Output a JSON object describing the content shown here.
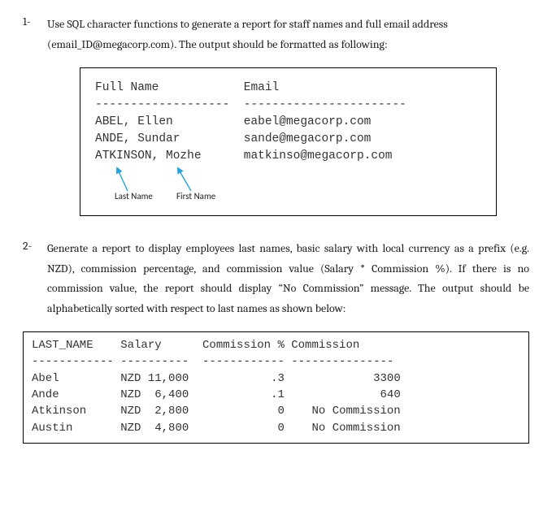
{
  "q1": {
    "number": "1-",
    "text_a": "Use SQL character functions to generate a report for staff names and full email address (email_ID@megacorp.com). The output should be formatted as following:",
    "header_full": "Full Name",
    "header_email": "Email",
    "dashes_full": "-------------------",
    "dashes_email": "-----------------------",
    "rows": [
      {
        "name": "ABEL, Ellen",
        "email": "eabel@megacorp.com"
      },
      {
        "name": "ANDE, Sundar",
        "email": "sande@megacorp.com"
      },
      {
        "name": "ATKINSON, Mozhe",
        "email": "matkinso@megacorp.com"
      }
    ],
    "annot_last": "Last Name",
    "annot_first": "First Name"
  },
  "q2": {
    "number": "2-",
    "text_a": "Generate a report to display employees last names, basic salary with local currency as a prefix (e.g. NZD), commission percentage, and commission value (Salary * Commission %). If there is no commission value, the report should display “No Commission” message. The output should be alphabetically sorted with respect to last names as shown below:",
    "header_line": "LAST_NAME    Salary      Commission % Commission",
    "dash_line": "------------ ----------  ------------ ---------------",
    "rows": [
      {
        "last": "Abel",
        "salary": "NZD 11,000",
        "pct": ".3",
        "comm": "3300"
      },
      {
        "last": "Ande",
        "salary": "NZD  6,400",
        "pct": ".1",
        "comm": "640"
      },
      {
        "last": "Atkinson",
        "salary": "NZD  2,800",
        "pct": "0",
        "comm": "No Commission"
      },
      {
        "last": "Austin",
        "salary": "NZD  4,800",
        "pct": "0",
        "comm": "No Commission"
      }
    ]
  },
  "chart_data": {
    "type": "table",
    "tables": [
      {
        "title": "Staff names and email",
        "columns": [
          "Full Name",
          "Email"
        ],
        "rows": [
          [
            "ABEL, Ellen",
            "eabel@megacorp.com"
          ],
          [
            "ANDE, Sundar",
            "sande@megacorp.com"
          ],
          [
            "ATKINSON, Mozhe",
            "matkinso@megacorp.com"
          ]
        ]
      },
      {
        "title": "Salary and commission",
        "columns": [
          "LAST_NAME",
          "Salary",
          "Commission %",
          "Commission"
        ],
        "rows": [
          [
            "Abel",
            "NZD 11,000",
            ".3",
            "3300"
          ],
          [
            "Ande",
            "NZD 6,400",
            ".1",
            "640"
          ],
          [
            "Atkinson",
            "NZD 2,800",
            "0",
            "No Commission"
          ],
          [
            "Austin",
            "NZD 4,800",
            "0",
            "No Commission"
          ]
        ]
      }
    ]
  }
}
